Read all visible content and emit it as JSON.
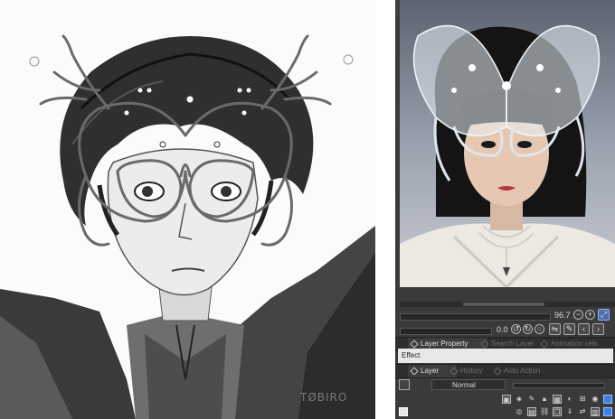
{
  "artwork": {
    "description_icon": "sketch-canvas",
    "signature": "TØBIRO"
  },
  "reference_panel": {
    "zoom_value": "96.7",
    "angle_value": "0.0",
    "zoom_in_glyph": "+",
    "zoom_out_glyph": "−",
    "fit_glyph": "⤢",
    "rotate_left_glyph": "↺",
    "rotate_right_glyph": "↻",
    "prev_glyph": "‹",
    "next_glyph": "›"
  },
  "property_tabs": [
    {
      "label": "Layer Property",
      "active": true,
      "icon": "layer-property-icon"
    },
    {
      "label": "Search Layer",
      "active": false,
      "icon": "search-layer-icon"
    },
    {
      "label": "Animation cels",
      "active": false,
      "icon": "animation-cels-icon"
    }
  ],
  "effect_label": "Effect",
  "layer_tabs": [
    {
      "label": "Layer",
      "active": true,
      "icon": "layer-icon"
    },
    {
      "label": "History",
      "active": false,
      "icon": "history-icon"
    },
    {
      "label": "Auto Action",
      "active": false,
      "icon": "auto-action-icon"
    }
  ],
  "blend_mode": "Normal",
  "layer_tool_icons": [
    "clip-icon",
    "ref-layer-icon",
    "draft-icon",
    "lock-icon",
    "lock-alpha-icon",
    "mask-icon",
    "ruler-icon",
    "palette-icon",
    "layer-color-icon",
    "visibility-icon"
  ],
  "colors": {
    "panel_bg": "#3a3a3a",
    "tab_active": "#3c3c3c",
    "accent": "#3f7fe0"
  }
}
